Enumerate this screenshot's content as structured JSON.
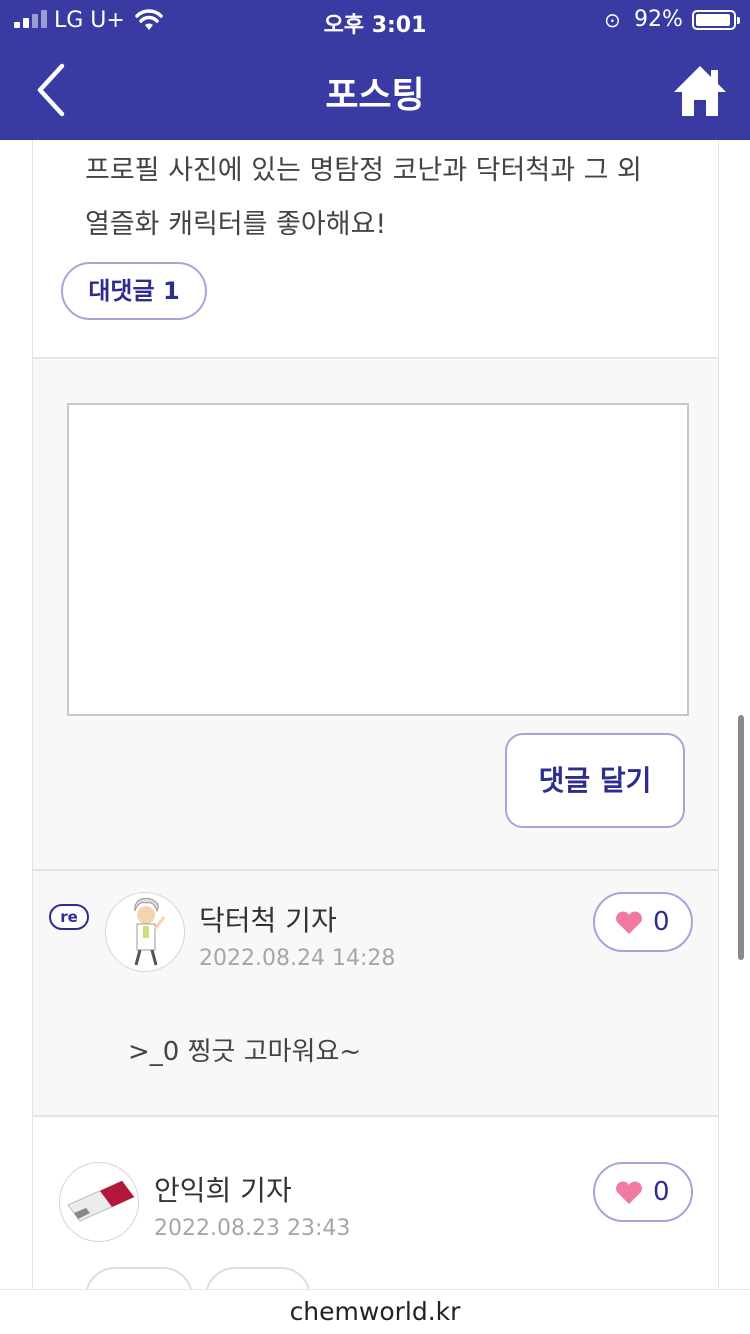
{
  "status_bar": {
    "carrier": "LG U+",
    "time": "오후 3:01",
    "battery": "92%"
  },
  "header": {
    "title": "포스팅",
    "back_icon": "chevron-left-icon",
    "home_icon": "home-icon",
    "color": "#3a3aa3"
  },
  "comment_top": {
    "text_line1": "프로필 사진에 있는 명탐정 코난과 닥터척과 그 외",
    "text_line2": "열즐화 캐릭터를 좋아해요!",
    "reply_count_label": "대댓글 1"
  },
  "reply_form": {
    "textarea_value": "",
    "submit_label": "댓글 달기"
  },
  "reply": {
    "badge": "re",
    "author": "닥터척 기자",
    "date": "2022.08.24 14:28",
    "likes": "0",
    "message": ">_0 찡긋 고마워요~"
  },
  "comment2": {
    "author": "안익희 기자",
    "date": "2022.08.23 23:43",
    "likes": "0"
  },
  "footer": {
    "domain": "chemworld.kr"
  }
}
